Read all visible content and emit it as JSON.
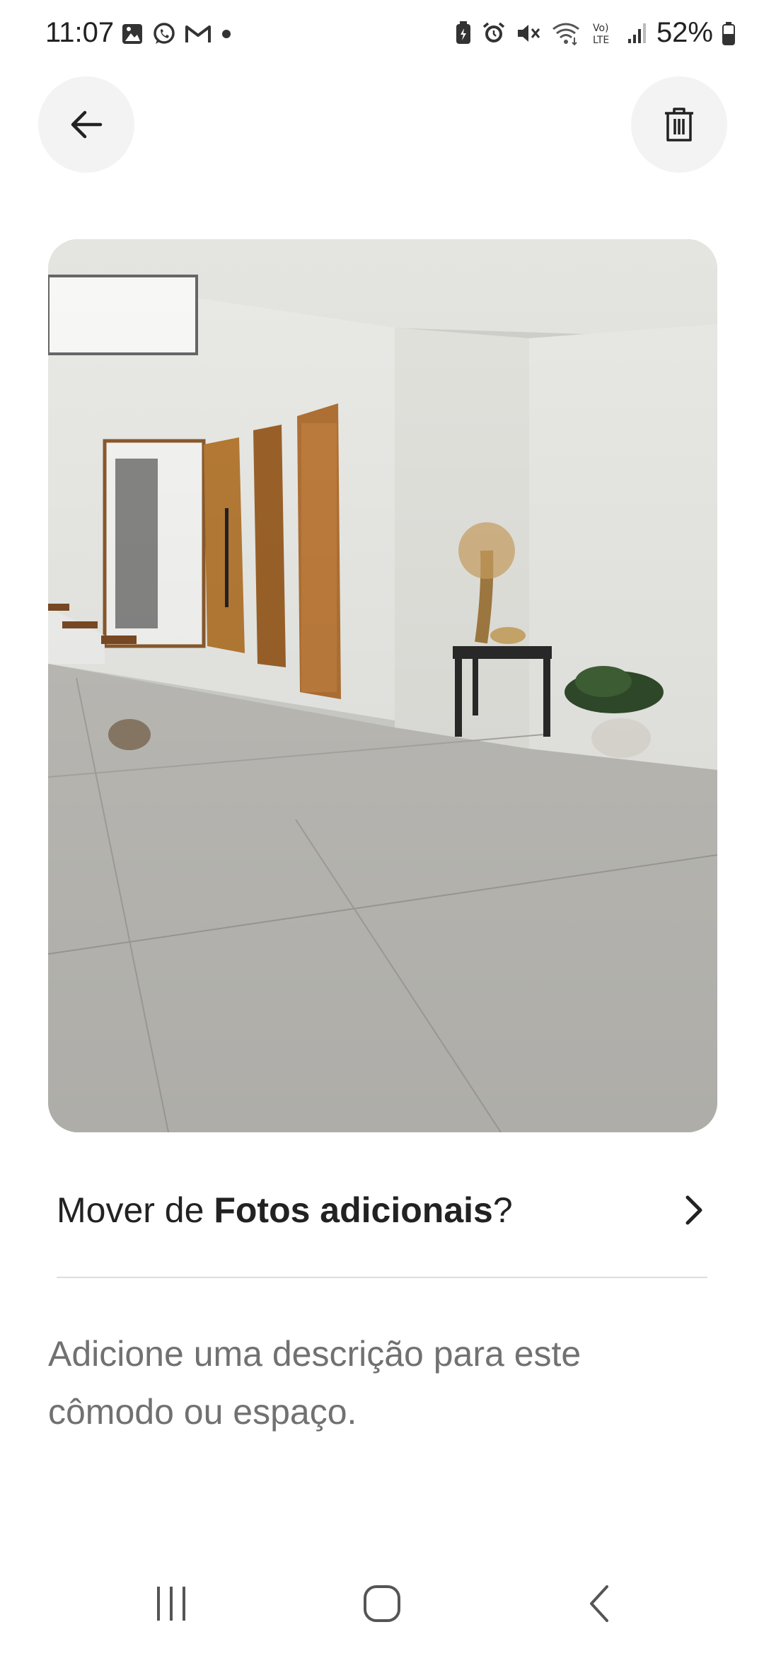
{
  "status_bar": {
    "time": "11:07",
    "battery_percent": "52%",
    "left_icons": [
      "gallery-icon",
      "whatsapp-icon",
      "gmail-icon",
      "dot-icon"
    ],
    "right_icons": [
      "battery-saver-icon",
      "alarm-icon",
      "mute-icon",
      "wifi-icon",
      "volte-icon",
      "signal-icon",
      "battery-icon"
    ]
  },
  "header": {
    "back_icon": "arrow-left-icon",
    "delete_icon": "trash-icon"
  },
  "photo": {
    "subject": "interior room photo"
  },
  "move": {
    "prefix": "Mover de ",
    "album": "Fotos adicionais",
    "suffix": "?",
    "icon": "chevron-right-icon"
  },
  "description": {
    "placeholder": "Adicione uma descrição para este cômodo ou espaço."
  },
  "nav": {
    "recents_icon": "recents-icon",
    "home_icon": "home-icon",
    "back_icon": "nav-back-icon"
  },
  "colors": {
    "text": "#222222",
    "muted": "#717171",
    "button_bg": "#f3f3f3",
    "divider": "#dddddd"
  }
}
